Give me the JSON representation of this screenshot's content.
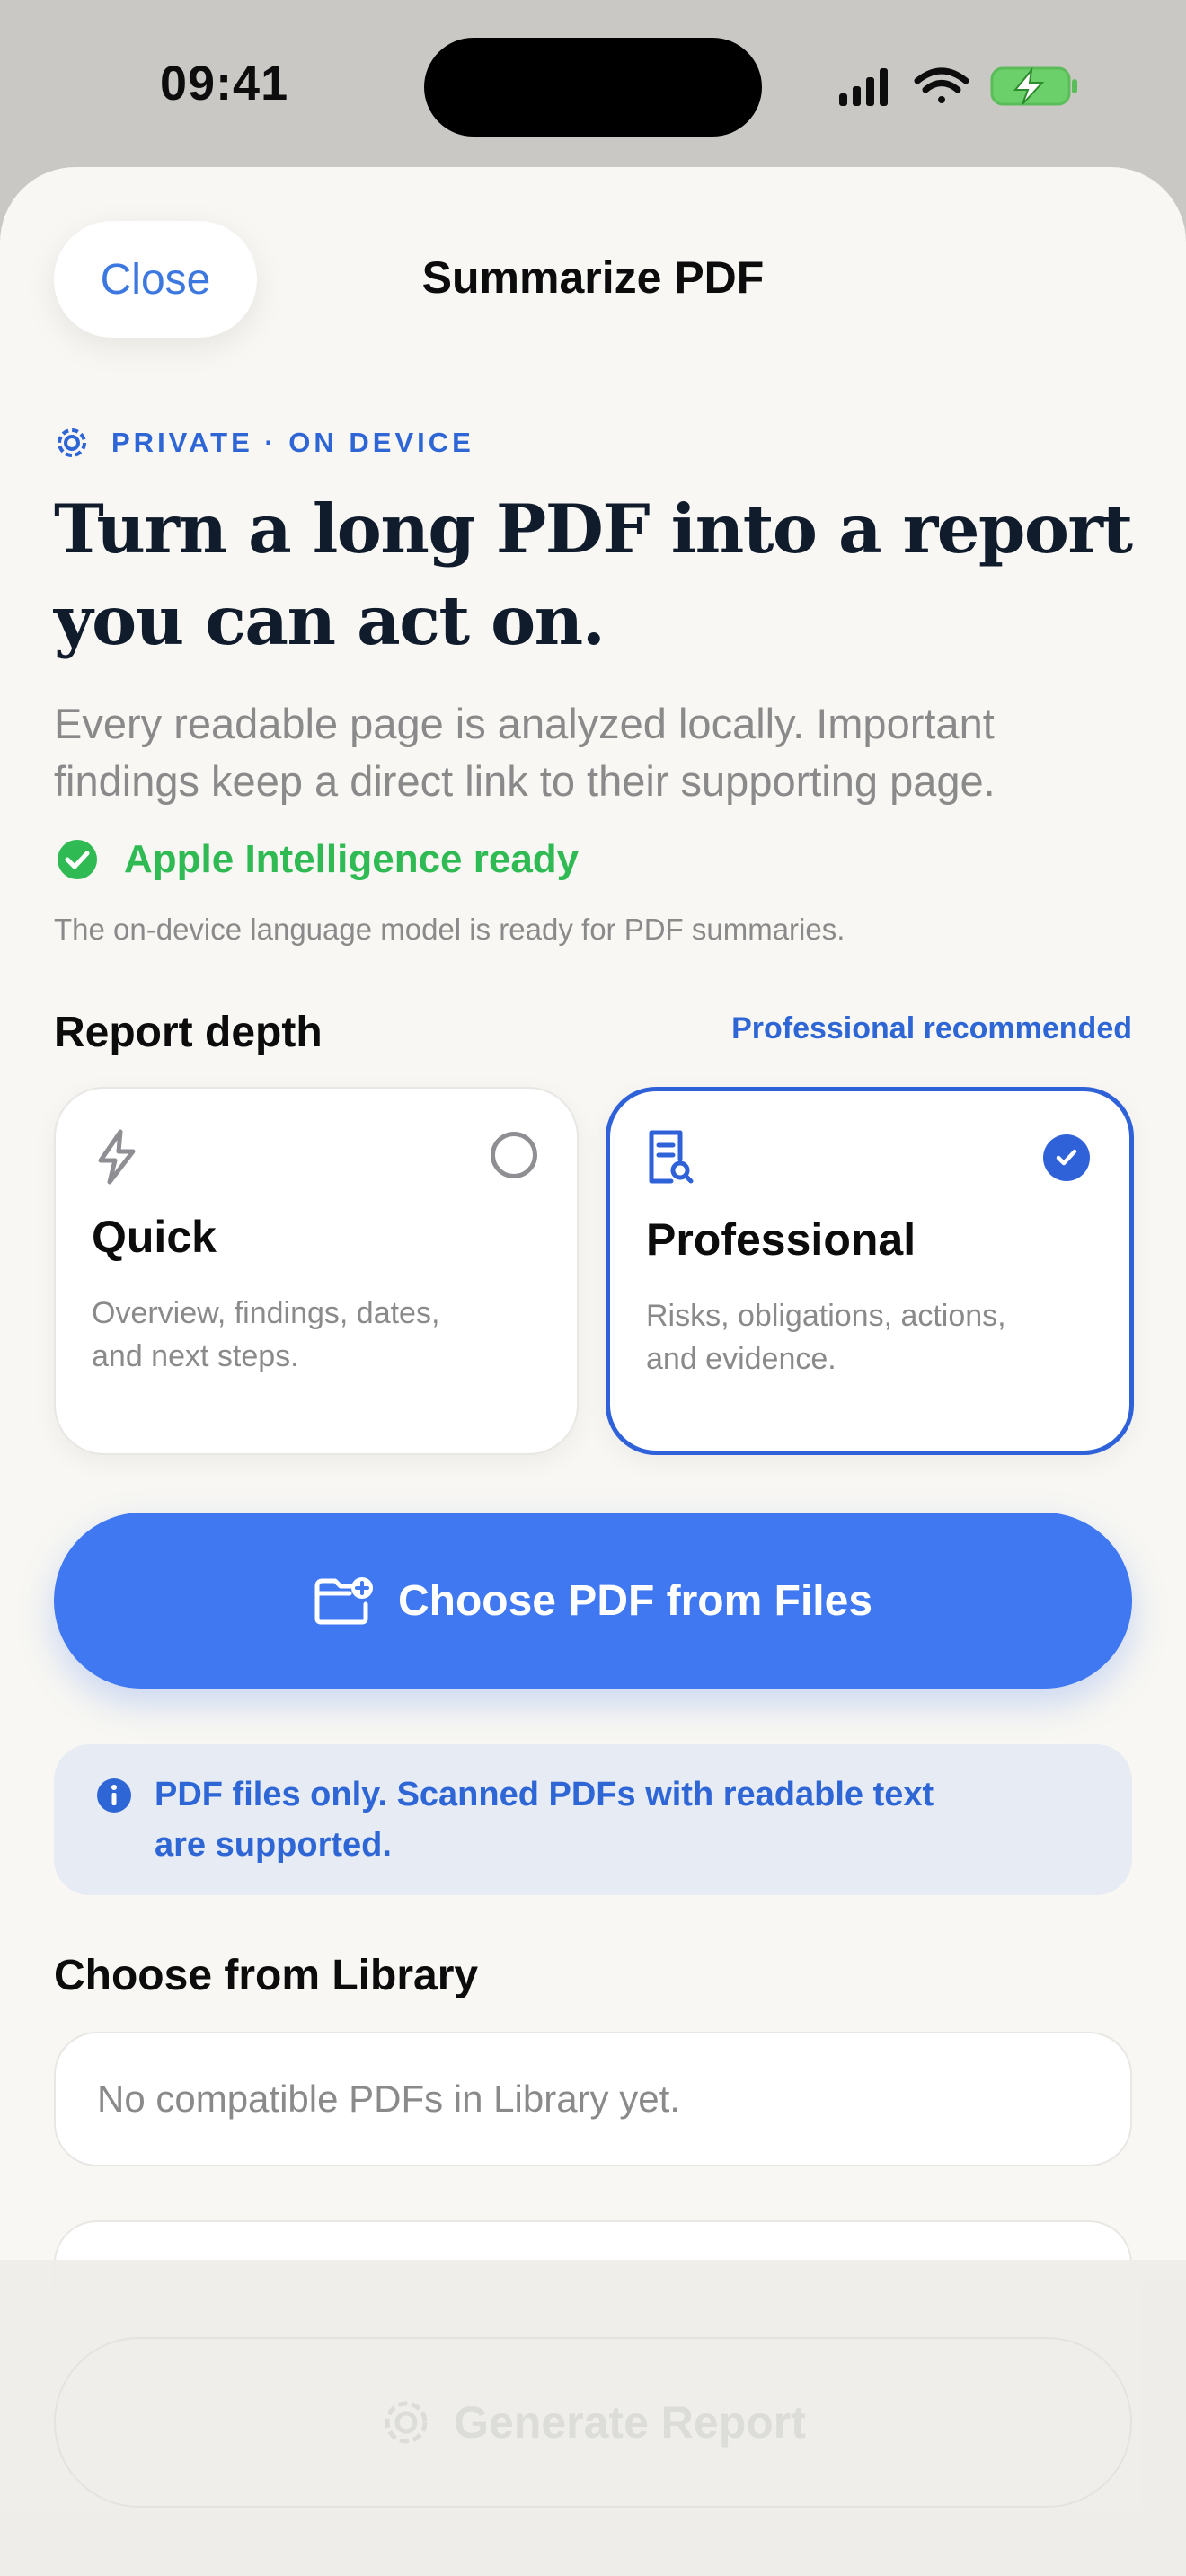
{
  "status_bar": {
    "time": "09:41"
  },
  "nav": {
    "close_label": "Close",
    "title": "Summarize PDF"
  },
  "hero": {
    "eyebrow": "PRIVATE · ON DEVICE",
    "headline_line1": "Turn a long PDF into a report",
    "headline_line2": "you can act on.",
    "subhead_line1": "Every readable page is analyzed locally. Important",
    "subhead_line2": "findings keep a direct link to their supporting page.",
    "status_label": "Apple Intelligence ready",
    "status_note": "The on-device language model is ready for PDF summaries."
  },
  "report_depth": {
    "title": "Report depth",
    "recommendation": "Professional recommended",
    "options": [
      {
        "icon": "bolt-icon",
        "title": "Quick",
        "desc_line1": "Overview, findings, dates,",
        "desc_line2": "and next steps.",
        "selected": false
      },
      {
        "icon": "document-search-icon",
        "title": "Professional",
        "desc_line1": "Risks, obligations, actions,",
        "desc_line2": "and evidence.",
        "selected": true
      }
    ]
  },
  "choose_files": {
    "label": "Choose PDF from Files",
    "icon": "folder-add-icon"
  },
  "notice": {
    "icon": "info-icon",
    "line1": "PDF files only. Scanned PDFs with readable text",
    "line2": "are supported."
  },
  "library": {
    "title": "Choose from Library",
    "empty_text": "No compatible PDFs in Library yet."
  },
  "generate": {
    "label": "Generate Report",
    "icon": "apple-intelligence-icon",
    "enabled": false
  },
  "colors": {
    "accent": "#2f66d6",
    "primary_button": "#3f78f1",
    "success": "#2fba53",
    "headline": "#101b2c",
    "sheet_background": "#f8f7f3"
  }
}
